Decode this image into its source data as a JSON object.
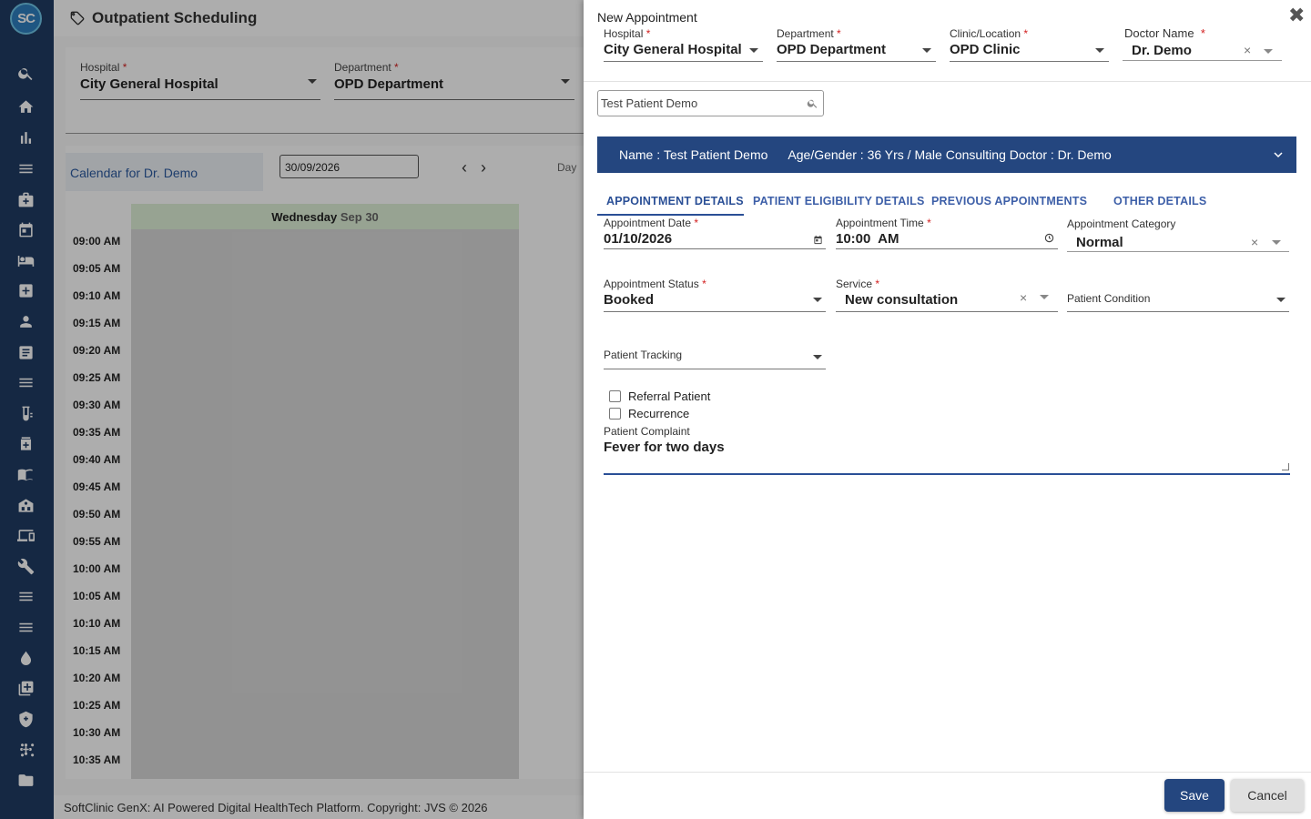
{
  "app": {
    "logo_text": "SC",
    "page_title": "Outpatient Scheduling",
    "footer": "SoftClinic GenX: AI Powered Digital HealthTech Platform. Copyright: JVS © 2026"
  },
  "sidebar": {
    "icons": [
      "search-icon",
      "home-icon",
      "bar-chart-icon",
      "menu-icon",
      "medical-bag-icon",
      "calendar-icon",
      "bed-icon",
      "medical-plus-icon",
      "person-icon",
      "document-icon",
      "list-icon",
      "lab-tubes-icon",
      "pharmacy-icon",
      "book-icon",
      "building-icon",
      "devices-icon",
      "wrench-icon",
      "menu-icon-2",
      "menu-icon-3",
      "drop-icon",
      "add-box-icon",
      "shield-icon",
      "network-icon",
      "folder-icon"
    ]
  },
  "background": {
    "hospital": {
      "label": "Hospital",
      "value": "City General Hospital"
    },
    "department": {
      "label": "Department",
      "value": "OPD Department"
    },
    "calendar_for": "Calendar for Dr. Demo",
    "date_value": "30/09/2026",
    "view_label": "Day",
    "day_header": {
      "weekday": "Wednesday",
      "date": "Sep 30"
    },
    "time_slots": [
      "09:00 AM",
      "09:05 AM",
      "09:10 AM",
      "09:15 AM",
      "09:20 AM",
      "09:25 AM",
      "09:30 AM",
      "09:35 AM",
      "09:40 AM",
      "09:45 AM",
      "09:50 AM",
      "09:55 AM",
      "10:00 AM",
      "10:05 AM",
      "10:10 AM",
      "10:15 AM",
      "10:20 AM",
      "10:25 AM",
      "10:30 AM",
      "10:35 AM"
    ]
  },
  "dialog": {
    "title": "New Appointment",
    "hospital": {
      "label": "Hospital",
      "value": "City General Hospital"
    },
    "department": {
      "label": "Department",
      "value": "OPD Department"
    },
    "clinic": {
      "label": "Clinic/Location",
      "value": "OPD Clinic"
    },
    "doctor": {
      "label": "Doctor Name",
      "value": "Dr. Demo"
    },
    "search": {
      "value": "Test Patient Demo"
    },
    "banner": {
      "name_label": "Name : ",
      "name_value": "Test Patient Demo",
      "age_label": "Age/Gender : ",
      "age_value": "36 Yrs / Male",
      "doctor_label": "Consulting Doctor : ",
      "doctor_value": "Dr. Demo"
    },
    "tabs": [
      "APPOINTMENT DETAILS",
      "PATIENT ELIGIBILITY DETAILS",
      "PREVIOUS APPOINTMENTS",
      "OTHER DETAILS"
    ],
    "active_tab": "APPOINTMENT DETAILS",
    "appointment_date": {
      "label": "Appointment Date",
      "value": "01/10/2026"
    },
    "appointment_time": {
      "label": "Appointment Time",
      "value": "10:00  AM"
    },
    "appointment_category": {
      "label": "Appointment Category",
      "value": "Normal"
    },
    "appointment_status": {
      "label": "Appointment Status",
      "value": "Booked"
    },
    "service": {
      "label": "Service",
      "value": "New consultation"
    },
    "patient_condition": {
      "label": "Patient Condition",
      "value": ""
    },
    "patient_tracking": {
      "label": "Patient Tracking",
      "value": ""
    },
    "referral_patient": {
      "label": "Referral Patient",
      "checked": false
    },
    "recurrence": {
      "label": "Recurrence",
      "checked": false
    },
    "patient_complaint": {
      "label": "Patient Complaint",
      "value": "Fever for two days"
    },
    "required_mark": "*",
    "clear_glyph": "×",
    "close_glyph": "✖",
    "save_label": "Save",
    "cancel_label": "Cancel"
  },
  "colors": {
    "sidebar_bg": "#1f3b63",
    "primary": "#24467f",
    "tab_text": "#3d5fa8",
    "required": "#d21f1f",
    "day_header_bg": "#dff0d8"
  }
}
